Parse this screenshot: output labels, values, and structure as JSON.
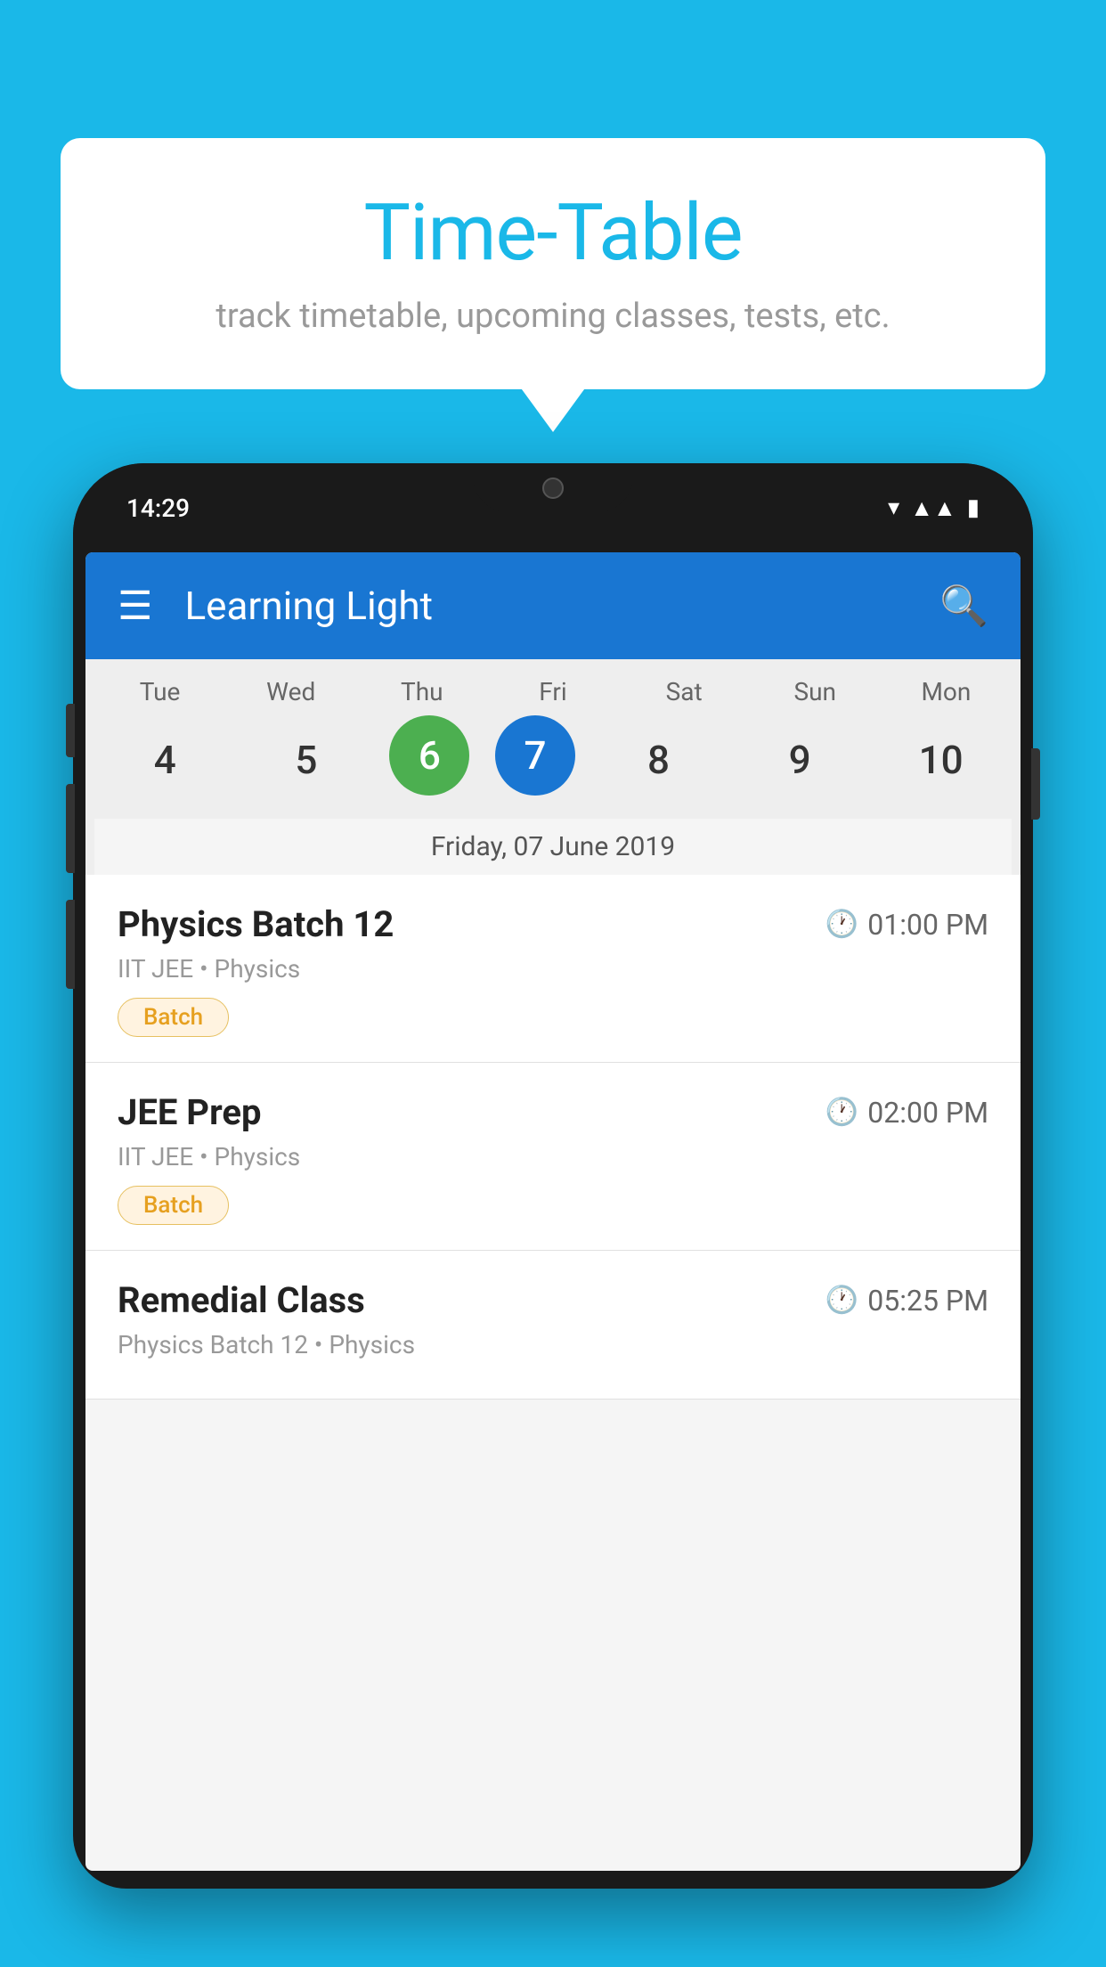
{
  "background_color": "#1ab8e8",
  "bubble": {
    "title": "Time-Table",
    "subtitle": "track timetable, upcoming classes, tests, etc."
  },
  "phone": {
    "status_bar": {
      "time": "14:29"
    },
    "app_bar": {
      "title": "Learning Light"
    },
    "calendar": {
      "days": [
        {
          "short": "Tue",
          "number": "4"
        },
        {
          "short": "Wed",
          "number": "5"
        },
        {
          "short": "Thu",
          "number": "6",
          "state": "today"
        },
        {
          "short": "Fri",
          "number": "7",
          "state": "selected"
        },
        {
          "short": "Sat",
          "number": "8"
        },
        {
          "short": "Sun",
          "number": "9"
        },
        {
          "short": "Mon",
          "number": "10"
        }
      ],
      "selected_date_label": "Friday, 07 June 2019"
    },
    "schedule": [
      {
        "title": "Physics Batch 12",
        "time": "01:00 PM",
        "subtitle": "IIT JEE • Physics",
        "badge": "Batch"
      },
      {
        "title": "JEE Prep",
        "time": "02:00 PM",
        "subtitle": "IIT JEE • Physics",
        "badge": "Batch"
      },
      {
        "title": "Remedial Class",
        "time": "05:25 PM",
        "subtitle": "Physics Batch 12 • Physics",
        "badge": null
      }
    ]
  }
}
